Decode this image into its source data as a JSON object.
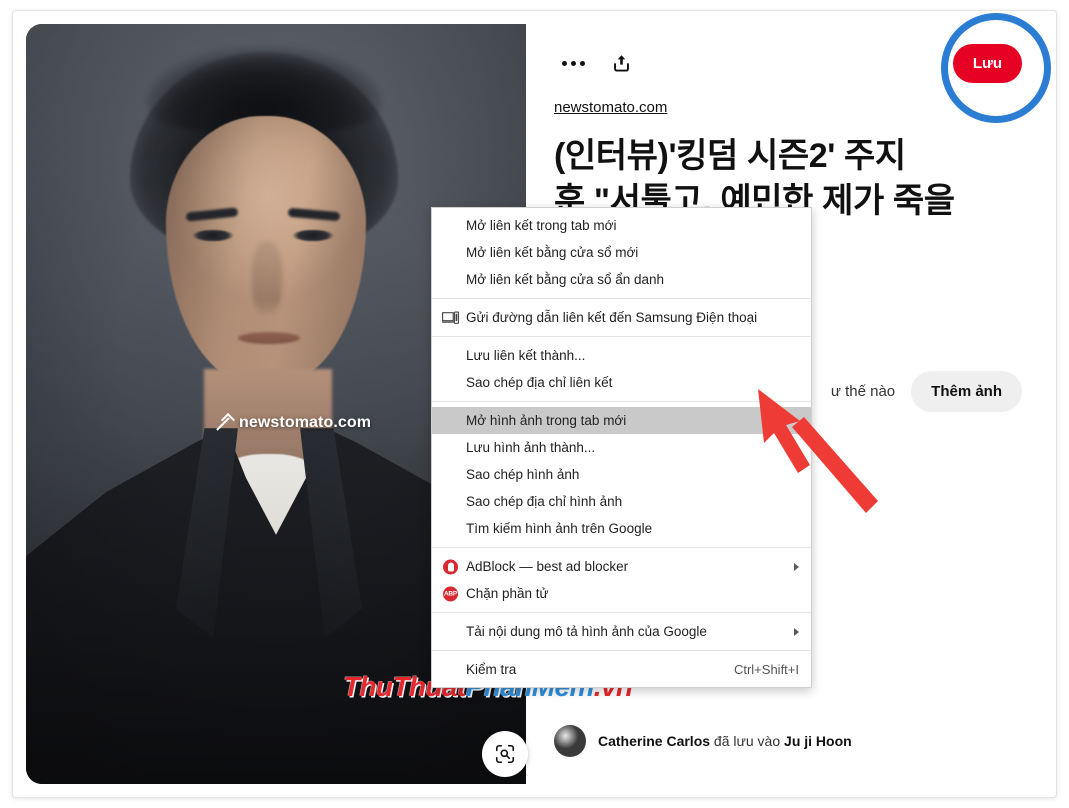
{
  "pin": {
    "source_link": "newstomato.com",
    "title": "(인터뷰)'킹덤 시즌2' 주지\n훈 \"서툴고, 예민한 제가 죽을",
    "image_overlay_source": "newstomato.com",
    "watermark": {
      "part1": "ThuThuat",
      "part2": "PhanMem",
      "part3": ".vn"
    },
    "saver": {
      "name": "Catherine Carlos",
      "middle_text": " đã lưu vào ",
      "board": "Ju ji Hoon"
    }
  },
  "actions": {
    "more_options_icon": "three-dots-icon",
    "share_icon": "share-upload-icon",
    "save_label": "Lưu",
    "lens_icon": "visual-search-lens-icon"
  },
  "add_photo": {
    "hint_text": "ư thế nào",
    "button_label": "Thêm ảnh"
  },
  "context_menu": {
    "groups": [
      {
        "items": [
          {
            "label": "Mở liên kết trong tab mới",
            "icon": null,
            "accel": "",
            "submenu": false,
            "highlight": false
          },
          {
            "label": "Mở liên kết bằng cửa sổ mới",
            "icon": null,
            "accel": "",
            "submenu": false,
            "highlight": false
          },
          {
            "label": "Mở liên kết bằng cửa sổ ẩn danh",
            "icon": null,
            "accel": "",
            "submenu": false,
            "highlight": false
          }
        ]
      },
      {
        "items": [
          {
            "label": "Gửi đường dẫn liên kết đến Samsung Điện thoại",
            "icon": "cast-to-device-icon",
            "accel": "",
            "submenu": false,
            "highlight": false
          }
        ]
      },
      {
        "items": [
          {
            "label": "Lưu liên kết thành...",
            "icon": null,
            "accel": "",
            "submenu": false,
            "highlight": false
          },
          {
            "label": "Sao chép địa chỉ liên kết",
            "icon": null,
            "accel": "",
            "submenu": false,
            "highlight": false
          }
        ]
      },
      {
        "items": [
          {
            "label": "Mở hình ảnh trong tab mới",
            "icon": null,
            "accel": "",
            "submenu": false,
            "highlight": true
          },
          {
            "label": "Lưu hình ảnh thành...",
            "icon": null,
            "accel": "",
            "submenu": false,
            "highlight": false
          },
          {
            "label": "Sao chép hình ảnh",
            "icon": null,
            "accel": "",
            "submenu": false,
            "highlight": false
          },
          {
            "label": "Sao chép địa chỉ hình ảnh",
            "icon": null,
            "accel": "",
            "submenu": false,
            "highlight": false
          },
          {
            "label": "Tìm kiếm hình ảnh trên Google",
            "icon": null,
            "accel": "",
            "submenu": false,
            "highlight": false
          }
        ]
      },
      {
        "items": [
          {
            "label": "AdBlock — best ad blocker",
            "icon": "adblock-icon",
            "accel": "",
            "submenu": true,
            "highlight": false
          },
          {
            "label": "Chặn phần tử",
            "icon": "adblock-plus-icon",
            "accel": "",
            "submenu": false,
            "highlight": false
          }
        ]
      },
      {
        "items": [
          {
            "label": "Tải nội dung mô tả hình ảnh của Google",
            "icon": null,
            "accel": "",
            "submenu": true,
            "highlight": false
          }
        ]
      },
      {
        "items": [
          {
            "label": "Kiểm tra",
            "icon": null,
            "accel": "Ctrl+Shift+I",
            "submenu": false,
            "highlight": false
          }
        ]
      }
    ]
  },
  "annotations": {
    "highlight_ring_color": "#2b7cd3",
    "arrow_color": "#ef3b35"
  },
  "colors": {
    "brand_red": "#e60023",
    "menu_highlight": "#c9c9c9"
  }
}
